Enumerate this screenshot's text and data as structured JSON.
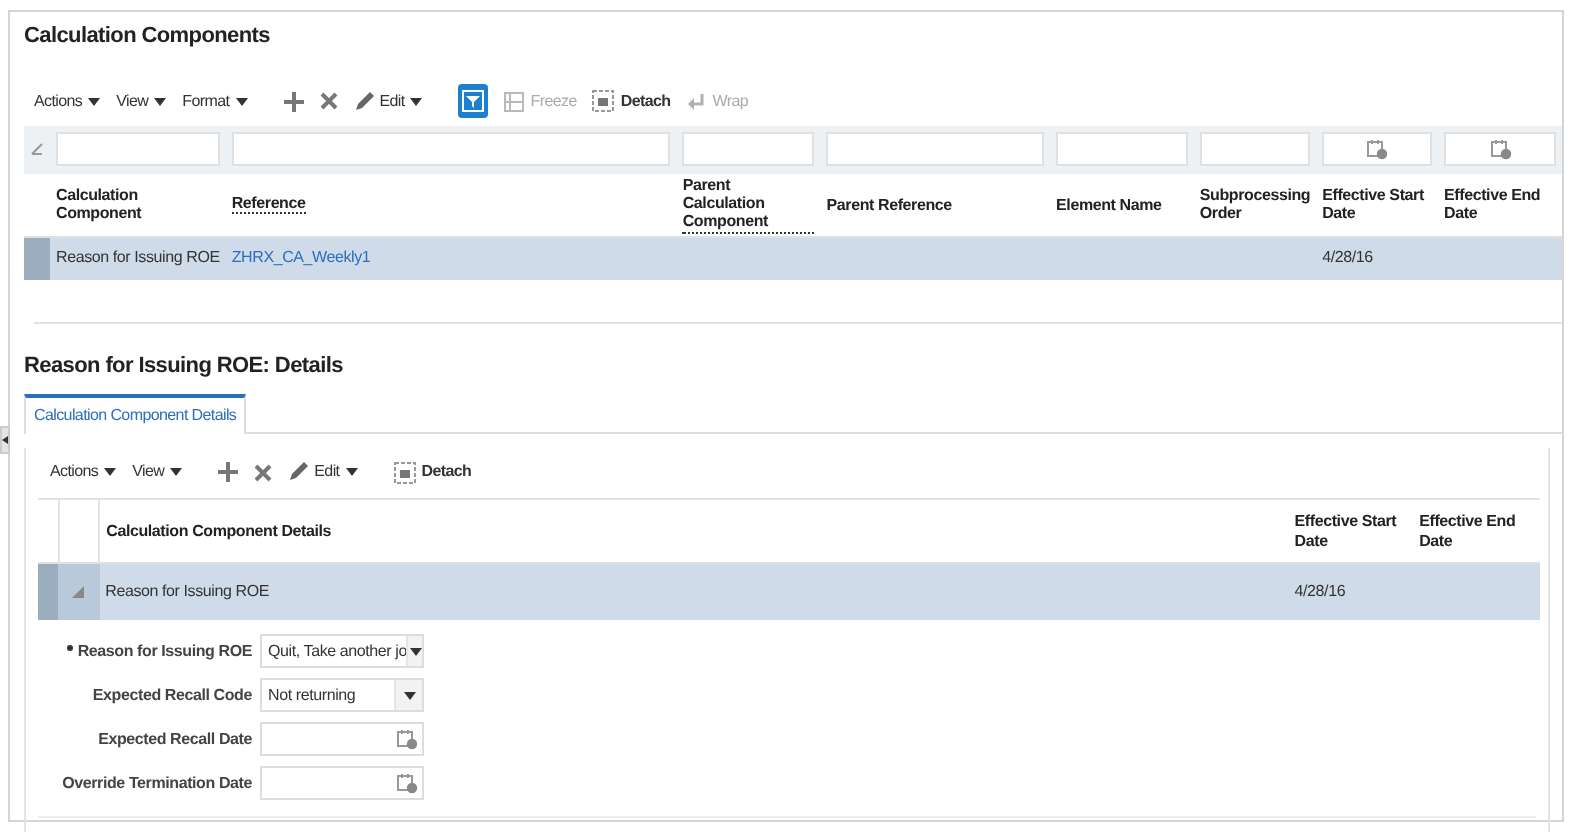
{
  "main_section": {
    "title": "Calculation Components",
    "toolbar": [
      {
        "kind": "menu",
        "label": "Actions",
        "disabled": false
      },
      {
        "kind": "menu",
        "label": "View",
        "disabled": false
      },
      {
        "kind": "menu",
        "label": "Format",
        "disabled": false
      },
      {
        "kind": "add",
        "disabled": false
      },
      {
        "kind": "delete",
        "disabled": false
      },
      {
        "kind": "edit",
        "label": "Edit",
        "disabled": false
      },
      {
        "kind": "filter",
        "selected": true,
        "disabled": false
      },
      {
        "kind": "freeze",
        "label": "Freeze",
        "disabled": true
      },
      {
        "kind": "detach",
        "label": "Detach",
        "disabled": false
      },
      {
        "kind": "wrap",
        "label": "Wrap",
        "disabled": true
      }
    ],
    "table": {
      "columns": [
        {
          "label": "Calculation Component",
          "date_filter": false,
          "dotted": false
        },
        {
          "label": "Reference",
          "date_filter": false,
          "dotted": true
        },
        {
          "label": "Parent Calculation Component",
          "date_filter": false,
          "dotted": true
        },
        {
          "label": "Parent Reference",
          "date_filter": false,
          "dotted": false
        },
        {
          "label": "Element Name",
          "date_filter": false,
          "dotted": false
        },
        {
          "label": "Subprocessing Order",
          "date_filter": false,
          "dotted": false
        },
        {
          "label": "Effective Start Date",
          "date_filter": true,
          "dotted": false
        },
        {
          "label": "Effective End Date",
          "date_filter": true,
          "dotted": false
        }
      ],
      "rows": [
        {
          "selected": true,
          "cells": [
            {
              "kind": "text",
              "text": "Reason for Issuing ROE"
            },
            {
              "kind": "link",
              "text": "ZHRX_CA_Weekly1"
            },
            {
              "text": ""
            },
            {
              "text": ""
            },
            {
              "text": ""
            },
            {
              "text": ""
            },
            {
              "kind": "text",
              "text": "4/28/16"
            }
          ]
        }
      ]
    }
  },
  "details_section": {
    "title": "Reason for Issuing ROE: Details",
    "tabs": [
      {
        "label": "Calculation Component Details",
        "selected": true
      }
    ],
    "toolbar": [
      {
        "kind": "menu",
        "label": "Actions",
        "disabled": false
      },
      {
        "kind": "menu",
        "label": "View",
        "disabled": false
      },
      {
        "kind": "add",
        "disabled": false
      },
      {
        "kind": "delete",
        "disabled": false
      },
      {
        "kind": "edit",
        "label": "Edit",
        "disabled": false
      },
      {
        "kind": "detach",
        "label": "Detach",
        "disabled": false
      }
    ],
    "table": {
      "columns": [
        {
          "label": "Calculation Component Details"
        },
        {
          "label": "Effective Start Date"
        },
        {
          "label": "Effective End Date"
        }
      ],
      "rows": [
        {
          "selected": true,
          "expanded": true,
          "cells": [
            {
              "text": "Reason for Issuing ROE"
            },
            {
              "text": "4/28/16"
            }
          ]
        }
      ]
    },
    "form": [
      {
        "label": "Reason for Issuing ROE",
        "required": true,
        "kind": "select",
        "value": "Quit, Take another jo"
      },
      {
        "label": "Expected Recall Code",
        "required": false,
        "kind": "select",
        "value": "Not returning"
      },
      {
        "label": "Expected Recall Date",
        "required": false,
        "kind": "date"
      },
      {
        "label": "Override Termination Date",
        "required": false,
        "kind": "date"
      }
    ]
  }
}
